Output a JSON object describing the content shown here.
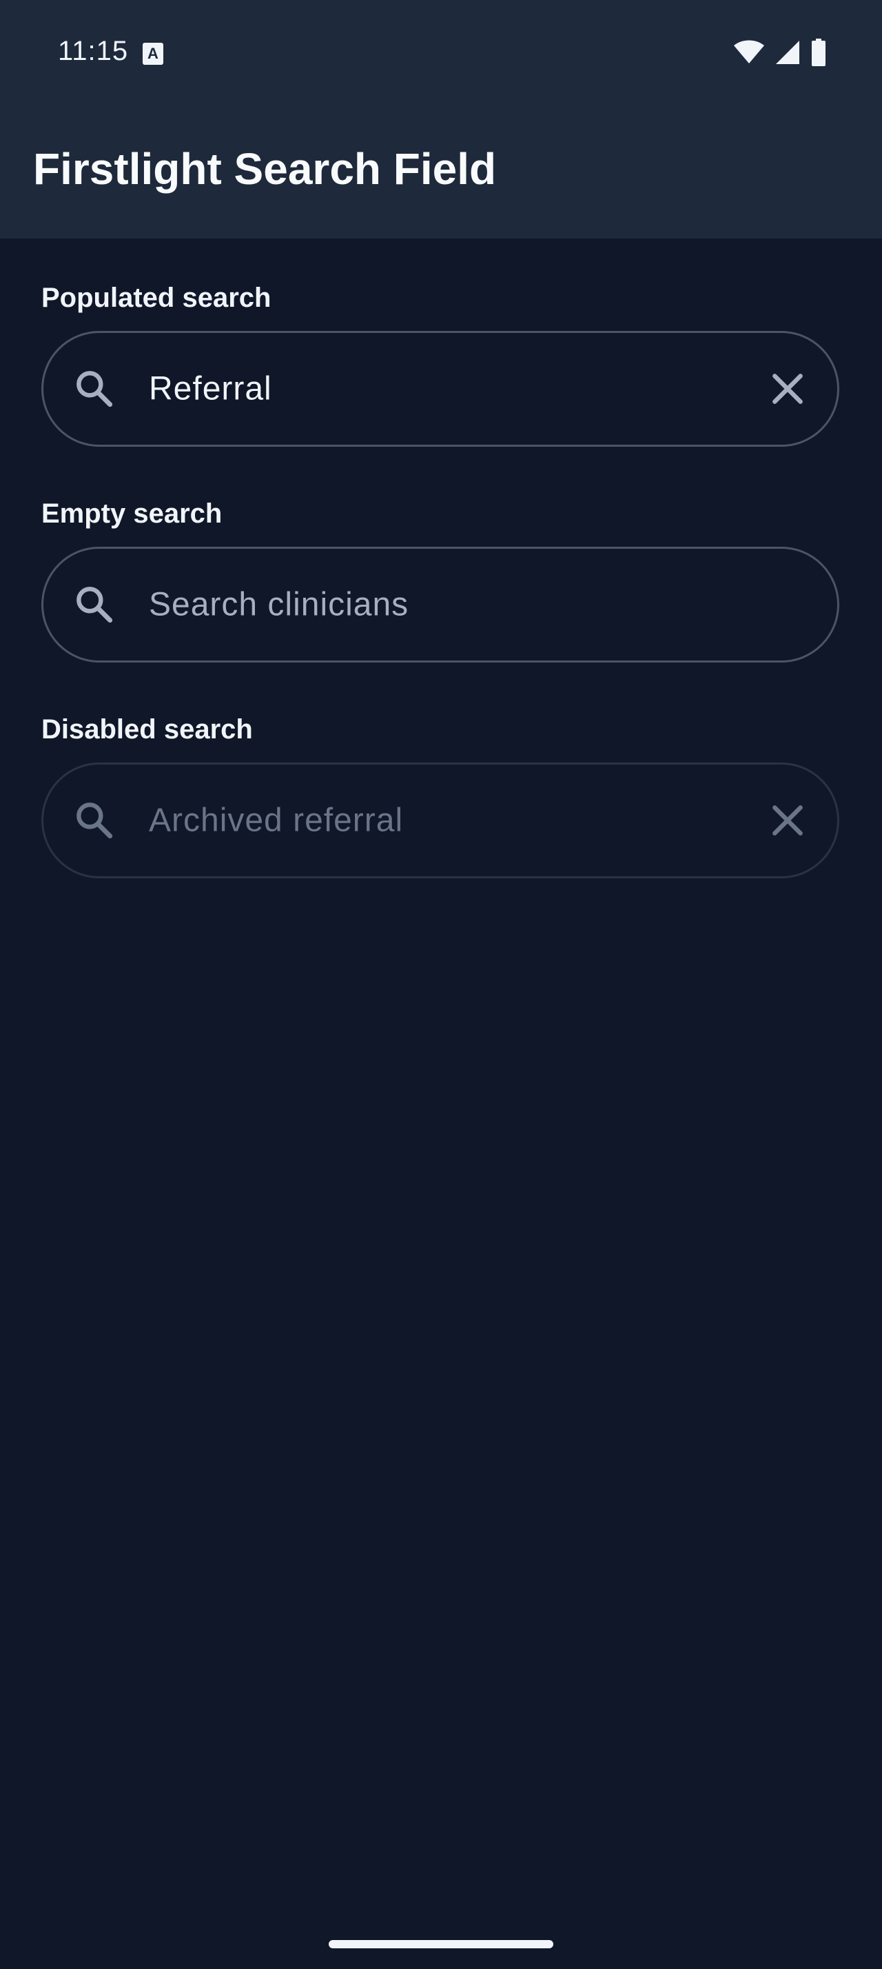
{
  "status_bar": {
    "time": "11:15",
    "notification_icon": "A",
    "icons": [
      "wifi-icon",
      "cell-signal-icon",
      "battery-icon"
    ]
  },
  "app_bar": {
    "title": "Firstlight Search Field"
  },
  "sections": [
    {
      "label": "Populated search",
      "value": "Referral",
      "placeholder": "",
      "state": "populated",
      "has_clear": true
    },
    {
      "label": "Empty search",
      "value": "",
      "placeholder": "Search clinicians",
      "state": "empty",
      "has_clear": false
    },
    {
      "label": "Disabled search",
      "value": "Archived referral",
      "placeholder": "",
      "state": "disabled",
      "has_clear": true
    }
  ],
  "colors": {
    "background": "#101729",
    "topbar": "#1e293b",
    "text": "#f1f5f9",
    "border": "#4b5566",
    "placeholder": "#a7b0bf",
    "disabled": "#6a7587"
  }
}
